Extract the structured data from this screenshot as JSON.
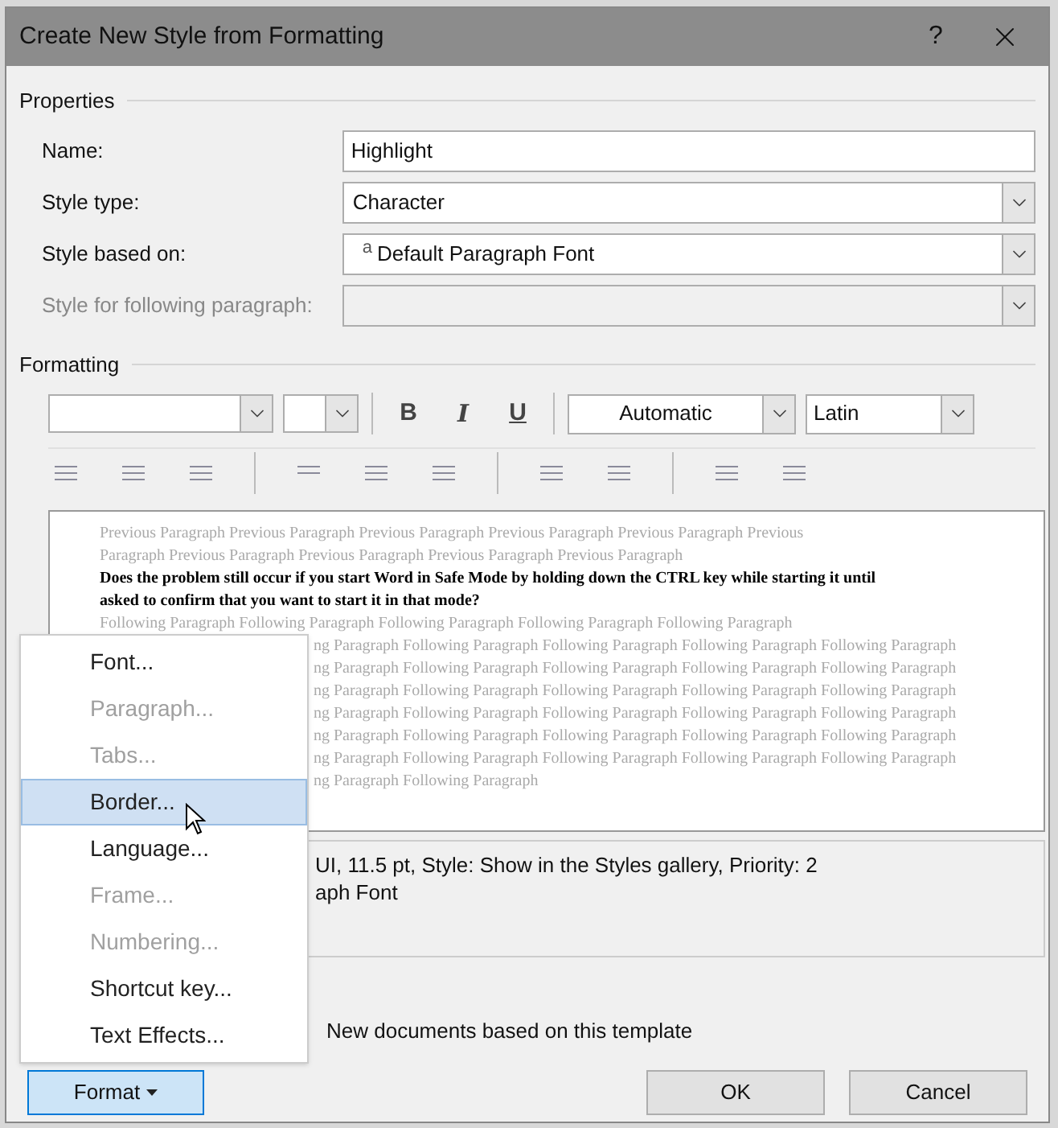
{
  "window": {
    "title": "Create New Style from Formatting",
    "help": "?"
  },
  "properties": {
    "heading": "Properties",
    "fields": [
      {
        "label": "Name:",
        "kind": "text",
        "value": "Highlight",
        "disabled": false
      },
      {
        "label": "Style type:",
        "kind": "dropdown",
        "value": "Character",
        "disabled": false
      },
      {
        "label": "Style based on:",
        "kind": "dropdown",
        "value": "Default Paragraph Font",
        "marker": "a",
        "disabled": false
      },
      {
        "label": "Style for following paragraph:",
        "kind": "dropdown",
        "disabled": true
      }
    ]
  },
  "formatting": {
    "heading": "Formatting",
    "bold": "B",
    "italic": "I",
    "underline": "U",
    "font_color": "Automatic",
    "script": "Latin"
  },
  "preview": {
    "previous_lines": [
      "Previous Paragraph Previous Paragraph Previous Paragraph Previous Paragraph Previous Paragraph Previous",
      "Paragraph Previous Paragraph Previous Paragraph Previous Paragraph Previous Paragraph"
    ],
    "sample_lines": [
      "Does the problem still occur if you start Word in Safe Mode by holding down the CTRL key while starting it until",
      "asked to confirm that you want to start it in that mode?"
    ],
    "following_lines": [
      "Following Paragraph Following Paragraph Following Paragraph Following Paragraph Following Paragraph",
      "ng Paragraph Following Paragraph Following Paragraph Following Paragraph Following Paragraph",
      "ng Paragraph Following Paragraph Following Paragraph Following Paragraph Following Paragraph",
      "ng Paragraph Following Paragraph Following Paragraph Following Paragraph Following Paragraph",
      "ng Paragraph Following Paragraph Following Paragraph Following Paragraph Following Paragraph",
      "ng Paragraph Following Paragraph Following Paragraph Following Paragraph Following Paragraph",
      "ng Paragraph Following Paragraph Following Paragraph Following Paragraph Following Paragraph",
      "ng Paragraph Following Paragraph"
    ]
  },
  "description": [
    "UI, 11.5 pt, Style: Show in the Styles gallery, Priority: 2",
    "aph Font"
  ],
  "template_option": "New documents based on this template",
  "format_menu": [
    {
      "label": "Font...",
      "disabled": false,
      "selected": false
    },
    {
      "label": "Paragraph...",
      "disabled": true,
      "selected": false
    },
    {
      "label": "Tabs...",
      "disabled": true,
      "selected": false
    },
    {
      "label": "Border...",
      "disabled": false,
      "selected": true
    },
    {
      "label": "Language...",
      "disabled": false,
      "selected": false
    },
    {
      "label": "Frame...",
      "disabled": true,
      "selected": false
    },
    {
      "label": "Numbering...",
      "disabled": true,
      "selected": false
    },
    {
      "label": "Shortcut key...",
      "disabled": false,
      "selected": false
    },
    {
      "label": "Text Effects...",
      "disabled": false,
      "selected": false
    }
  ],
  "buttons": [
    {
      "label": "Format",
      "kind": "menu",
      "selected": true
    },
    {
      "label": "OK",
      "kind": "plain",
      "selected": false
    },
    {
      "label": "Cancel",
      "kind": "plain",
      "selected": false
    }
  ]
}
